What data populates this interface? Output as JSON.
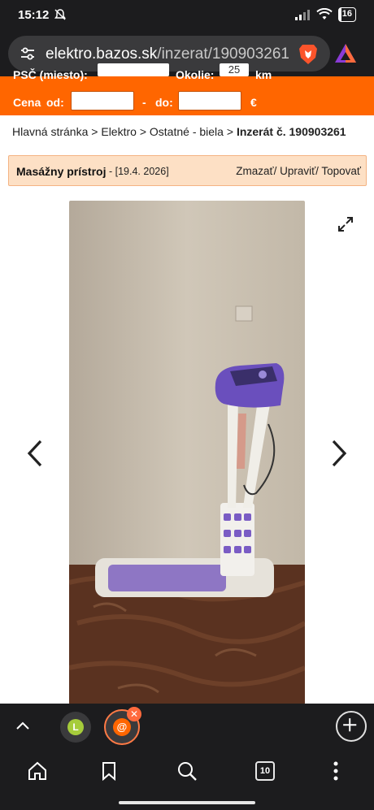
{
  "status": {
    "time": "15:12",
    "battery": "16"
  },
  "browser": {
    "url_host": "elektro.bazos.sk",
    "url_path": "/inzerat/190903261",
    "tab_count": "10"
  },
  "search": {
    "location_label": "PSČ (miesto):",
    "radius_label": "Okolie:",
    "radius_value": "25",
    "radius_unit": "km",
    "price_label": "Cena",
    "from_label": "od:",
    "to_separator": "-",
    "to_label": "do:",
    "currency": "€"
  },
  "breadcrumb": {
    "home": "Hlavná stránka",
    "sep": ">",
    "cat1": "Elektro",
    "cat2": "Ostatné - biela",
    "current": "Inzerát č. 190903261"
  },
  "listing": {
    "title": "Masážny prístroj",
    "date": "- [19.4. 2026]",
    "actions": "Zmazať/ Upraviť/ Topovať"
  },
  "tabs": {
    "tab1_letter": "L",
    "tab2_letter": "@",
    "close_glyph": "✕"
  }
}
